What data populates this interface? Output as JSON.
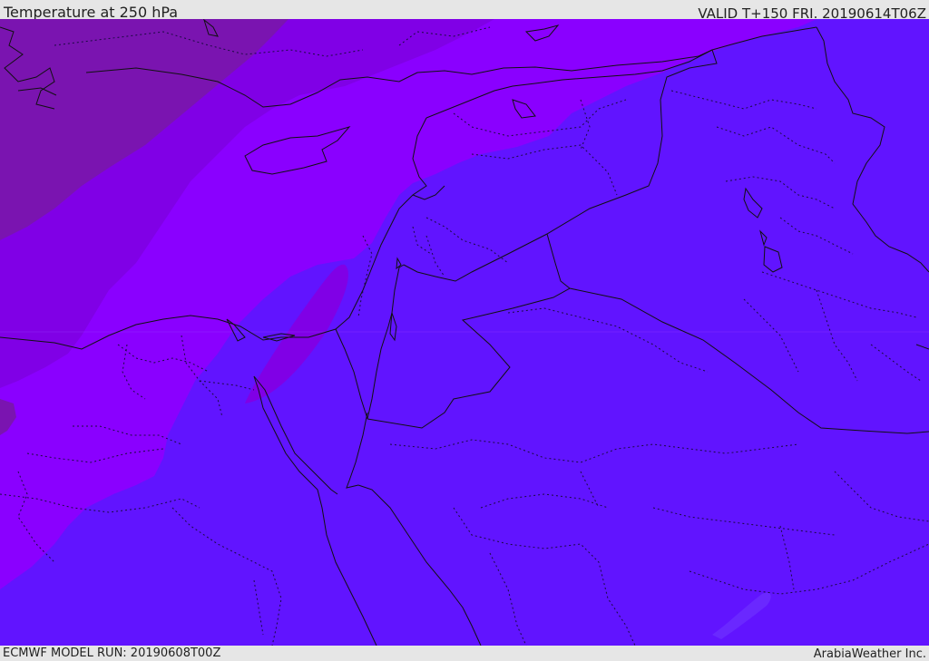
{
  "header": {
    "title": "Temperature at 250 hPa",
    "valid": "VALID T+150 FRI. 20190614T06Z"
  },
  "footer": {
    "model_run": "ECMWF MODEL RUN: 20190608T00Z",
    "credit": "ArabiaWeather Inc."
  },
  "map": {
    "colors": {
      "coldest": "#7a14b0",
      "cold": "#8000e6",
      "cool": "#8a00ff",
      "base": "#6114ff",
      "warm_patch": "#6a28ff",
      "borders": "#111111",
      "frame": "#e6e6e6"
    }
  }
}
